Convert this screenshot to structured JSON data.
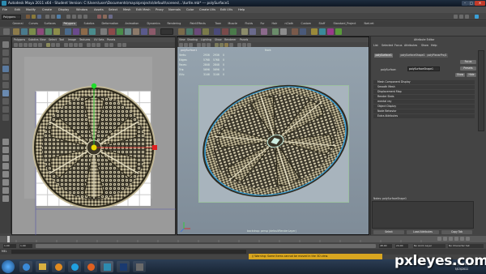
{
  "window": {
    "title": "Autodesk Maya 2011 x64 - Student Version: C:\\Users\\user\\Documents\\maya\\projects\\default\\scenes\\...\\turtle.mb*  ---  polySurface1",
    "min_label": "–",
    "max_label": "□",
    "close_label": "✕"
  },
  "menubar": {
    "items": [
      "File",
      "Edit",
      "Modify",
      "Create",
      "Display",
      "Window",
      "Assets",
      "Select",
      "Mesh",
      "Edit Mesh",
      "Proxy",
      "Normals",
      "Color",
      "Create UVs",
      "Edit UVs",
      "Help"
    ]
  },
  "statusline": {
    "mode_value": "Polygons"
  },
  "shelf": {
    "tabs": [
      "General",
      "Curves",
      "Surfaces",
      "Polygons",
      "Subdivs",
      "Deformation",
      "Animation",
      "Dynamics",
      "Rendering",
      "PaintEffects",
      "Toon",
      "Muscle",
      "Fluids",
      "Fur",
      "Hair",
      "nCloth",
      "Custom",
      "Stuff",
      "Standard_Project",
      "Nwt.ret"
    ],
    "active_tab": "Polygons"
  },
  "uv_editor": {
    "menu": [
      "Polygons",
      "Subdivs",
      "View",
      "Select",
      "Tool",
      "Image",
      "Textures",
      "UV Sets",
      "Panels"
    ]
  },
  "viewport": {
    "menu": [
      "View",
      "Shading",
      "Lighting",
      "Show",
      "Renderer",
      "Panels"
    ],
    "hud_header": "polySurface1",
    "hud_rows": [
      {
        "label": "Verts:",
        "a": "2936",
        "b": "2936",
        "c": "0"
      },
      {
        "label": "Edges:",
        "a": "5768",
        "b": "5768",
        "c": "0"
      },
      {
        "label": "Faces:",
        "a": "2848",
        "b": "2848",
        "c": "0"
      },
      {
        "label": "Tris:",
        "a": "5696",
        "b": "5696",
        "c": "0"
      },
      {
        "label": "UVs:",
        "a": "3146",
        "b": "3146",
        "c": "0"
      }
    ],
    "camera_label": "front",
    "bottom_label": "backdrop: persp (defaultRenderLayer)"
  },
  "attribute_editor": {
    "title": "Attribute Editor",
    "menu": [
      "List",
      "Selected",
      "Focus",
      "Attributes",
      "Show",
      "Help"
    ],
    "tabs": [
      "polySurface1",
      "polySurfaceShape1",
      "polyPlanarProj1"
    ],
    "field_label": "polySurface:",
    "field_value": "polySurfaceShape1",
    "buttons": [
      "Focus",
      "Presets",
      "Show",
      "Hide"
    ],
    "sections": [
      "Mesh Component Display",
      "Smooth Mesh",
      "Displacement Map",
      "Render Stats",
      "mental ray",
      "Object Display",
      "Node Behavior",
      "Extra Attributes"
    ],
    "notes_label": "Notes: polySurfaceShape1",
    "bottom_buttons": [
      "Select",
      "Load Attributes",
      "Copy Tab"
    ]
  },
  "timeline": {
    "start": "1.00",
    "end": "24.00",
    "playback_start": "1.00",
    "playback_end": "48.00",
    "anim_layer": "No Anim Layer",
    "char_set": "No Character Set"
  },
  "command_line": {
    "lang": "MEL",
    "warning": "// Warning: Some items cannot be moved in the 3D view."
  },
  "taskbar": {
    "time": "Sunday, May 15, 2011",
    "date": "5/15/2011"
  },
  "watermark": "pxleyes.com",
  "colors": {
    "accent": "#d9a620",
    "selection": "#3aa0d8",
    "manip_green": "#1fdc2a",
    "manip_red": "#e02020",
    "pivot_yellow": "#e8d400"
  }
}
